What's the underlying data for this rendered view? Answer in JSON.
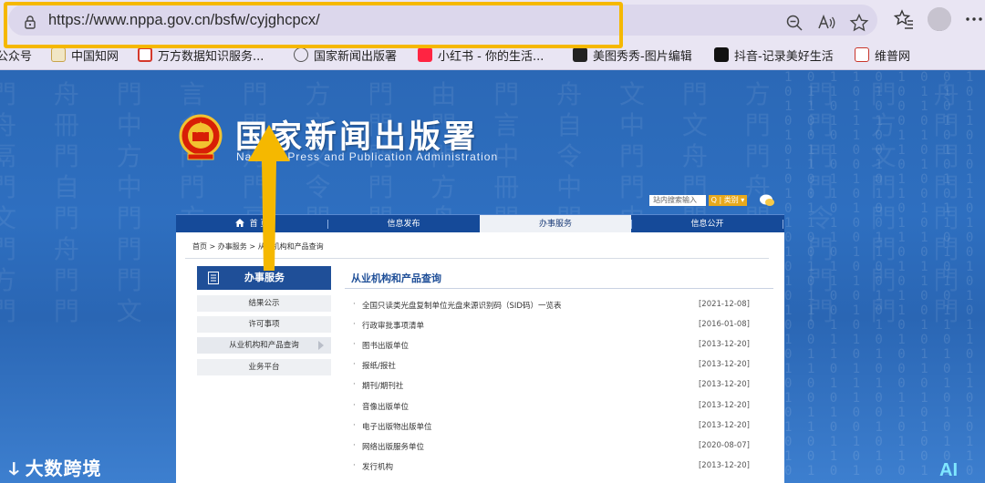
{
  "browser": {
    "url": "https://www.nppa.gov.cn/bsfw/cyjghcpcx/",
    "bookmarks": [
      {
        "label": "公众号",
        "color": "#2a2a2a"
      },
      {
        "label": "中国知网",
        "color": "#c8a34a"
      },
      {
        "label": "万方数据知识服务...",
        "color": "#d4382c"
      },
      {
        "label": "国家新闻出版署",
        "color": "#555555"
      },
      {
        "label": "小红书 - 你的生活...",
        "color": "#ff2442"
      },
      {
        "label": "美图秀秀-图片编辑",
        "color": "#222222"
      },
      {
        "label": "抖音-记录美好生活",
        "color": "#111111"
      },
      {
        "label": "维普网",
        "color": "#c8352b"
      }
    ],
    "annotation_color": "#f5b800"
  },
  "site": {
    "title": "国家新闻出版署",
    "subtitle": "National Press and Publication Administration",
    "search_placeholder": "站内搜索输入",
    "search_button": "Q | 类别 ▾",
    "nav": [
      {
        "label": "首 页",
        "active": false
      },
      {
        "label": "信息发布",
        "active": false
      },
      {
        "label": "办事服务",
        "active": true
      },
      {
        "label": "信息公开",
        "active": false
      }
    ],
    "breadcrumb": "首页 > 办事服务 > 从业机构和产品查询",
    "sidebar": {
      "heading": "办事服务",
      "items": [
        {
          "label": "结果公示",
          "active": false
        },
        {
          "label": "许可事项",
          "active": false
        },
        {
          "label": "从业机构和产品查询",
          "active": true
        },
        {
          "label": "业务平台",
          "active": false
        }
      ]
    },
    "main": {
      "title": "从业机构和产品查询",
      "rows": [
        {
          "bullet": "·",
          "title": "全国只读类光盘复制单位光盘来源识别码（SID码）一览表",
          "date": "[2021-12-08]"
        },
        {
          "bullet": "·",
          "title": "行政审批事项清单",
          "date": "[2016-01-08]"
        },
        {
          "bullet": "·",
          "title": "图书出版单位",
          "date": "[2013-12-20]"
        },
        {
          "bullet": "·",
          "title": "报纸/报社",
          "date": "[2013-12-20]"
        },
        {
          "bullet": "·",
          "title": "期刊/期刊社",
          "date": "[2013-12-20]"
        },
        {
          "bullet": "·",
          "title": "音像出版单位",
          "date": "[2013-12-20]"
        },
        {
          "bullet": "·",
          "title": "电子出版物出版单位",
          "date": "[2013-12-20]"
        },
        {
          "bullet": "·",
          "title": "网络出版服务单位",
          "date": "[2020-08-07]"
        },
        {
          "bullet": "·",
          "title": "发行机构",
          "date": "[2013-12-20]"
        }
      ]
    }
  },
  "overlay": {
    "watermark": "大数跨境",
    "ai_badge": "AI"
  }
}
